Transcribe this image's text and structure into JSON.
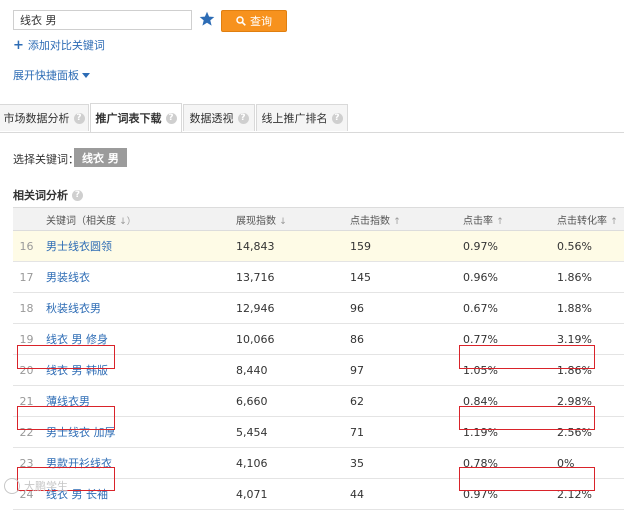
{
  "search": {
    "value": "线衣 男",
    "query_label": "查询"
  },
  "links": {
    "add_compare": "添加对比关键词",
    "expand_panel": "展开快捷面板"
  },
  "tabs": [
    {
      "label": "市场数据分析",
      "active": false
    },
    {
      "label": "推广词表下载",
      "active": true
    },
    {
      "label": "数据透视",
      "active": false
    },
    {
      "label": "线上推广排名",
      "active": false
    }
  ],
  "selected_keyword": {
    "label": "选择关键词：",
    "value": "线衣 男"
  },
  "section": {
    "title": "相关词分析"
  },
  "table": {
    "headers": {
      "keyword": "关键词（相关度",
      "impressions": "展现指数",
      "clicks": "点击指数",
      "ctr": "点击率",
      "cvr": "点击转化率"
    },
    "rows": [
      {
        "idx": "16",
        "keyword": "男士线衣圆领",
        "impressions": "14,843",
        "clicks": "159",
        "ctr": "0.97%",
        "cvr": "0.56%"
      },
      {
        "idx": "17",
        "keyword": "男装线衣",
        "impressions": "13,716",
        "clicks": "145",
        "ctr": "0.96%",
        "cvr": "1.86%"
      },
      {
        "idx": "18",
        "keyword": "秋装线衣男",
        "impressions": "12,946",
        "clicks": "96",
        "ctr": "0.67%",
        "cvr": "1.88%"
      },
      {
        "idx": "19",
        "keyword": "线衣 男 修身",
        "impressions": "10,066",
        "clicks": "86",
        "ctr": "0.77%",
        "cvr": "3.19%"
      },
      {
        "idx": "20",
        "keyword": "线衣 男 韩版",
        "impressions": "8,440",
        "clicks": "97",
        "ctr": "1.05%",
        "cvr": "1.86%"
      },
      {
        "idx": "21",
        "keyword": "薄线衣男",
        "impressions": "6,660",
        "clicks": "62",
        "ctr": "0.84%",
        "cvr": "2.98%"
      },
      {
        "idx": "22",
        "keyword": "男士线衣 加厚",
        "impressions": "5,454",
        "clicks": "71",
        "ctr": "1.19%",
        "cvr": "2.56%"
      },
      {
        "idx": "23",
        "keyword": "男款开衫线衣",
        "impressions": "4,106",
        "clicks": "35",
        "ctr": "0.78%",
        "cvr": "0%"
      },
      {
        "idx": "24",
        "keyword": "线衣 男 长袖",
        "impressions": "4,071",
        "clicks": "44",
        "ctr": "0.97%",
        "cvr": "2.12%"
      }
    ]
  },
  "watermark": "大鹏学生",
  "colors": {
    "accent_orange": "#f7921e",
    "link_blue": "#2d6cb5",
    "highlight_red": "#d9232a",
    "row_highlight": "#fefbe6"
  }
}
